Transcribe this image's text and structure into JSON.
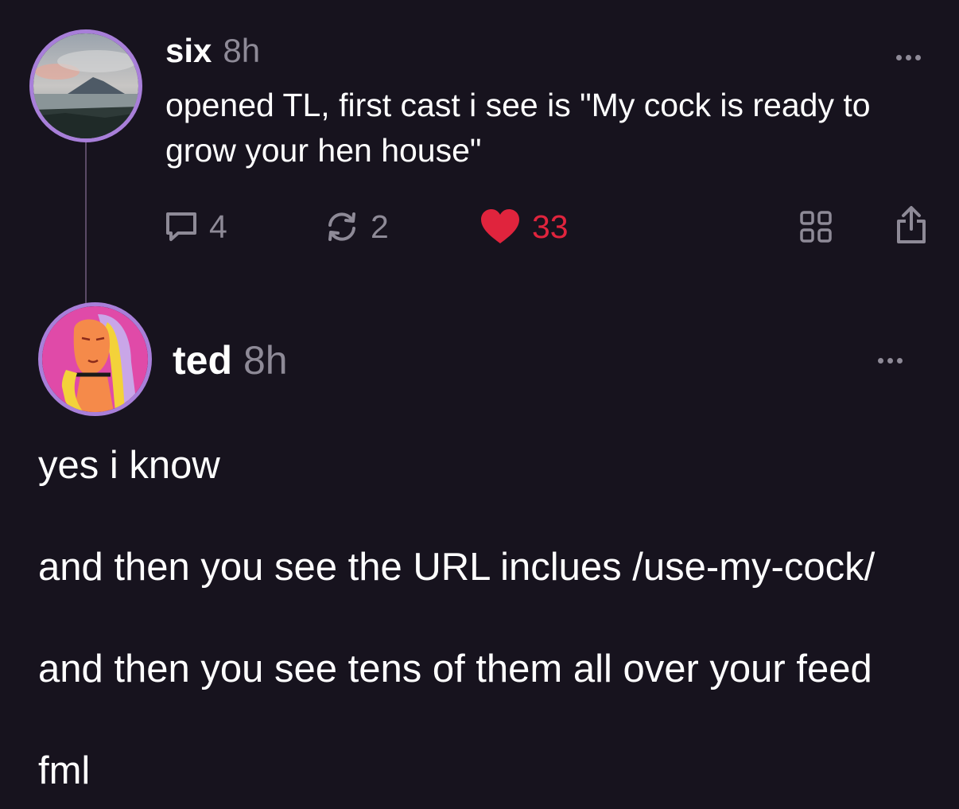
{
  "cast": {
    "author": "six",
    "time": "8h",
    "text": "opened TL, first cast i see is \"My cock is ready to grow your hen house\"",
    "actions": {
      "replies": "4",
      "recasts": "2",
      "likes": "33"
    }
  },
  "reply": {
    "author": "ted",
    "time": "8h",
    "paragraphs": [
      "yes i know",
      "and then you see the URL inclues /use-my-cock/",
      "and then you see tens of them all over your feed",
      "fml"
    ]
  },
  "colors": {
    "background": "#17131e",
    "muted": "#8e8a97",
    "like": "#e0243d",
    "avatar_ring": "#a87fd9"
  },
  "icons": {
    "reply": "comment-icon",
    "recast": "recast-icon",
    "like": "heart-icon",
    "grid": "grid-icon",
    "share": "share-icon",
    "more": "more-dots-icon"
  }
}
